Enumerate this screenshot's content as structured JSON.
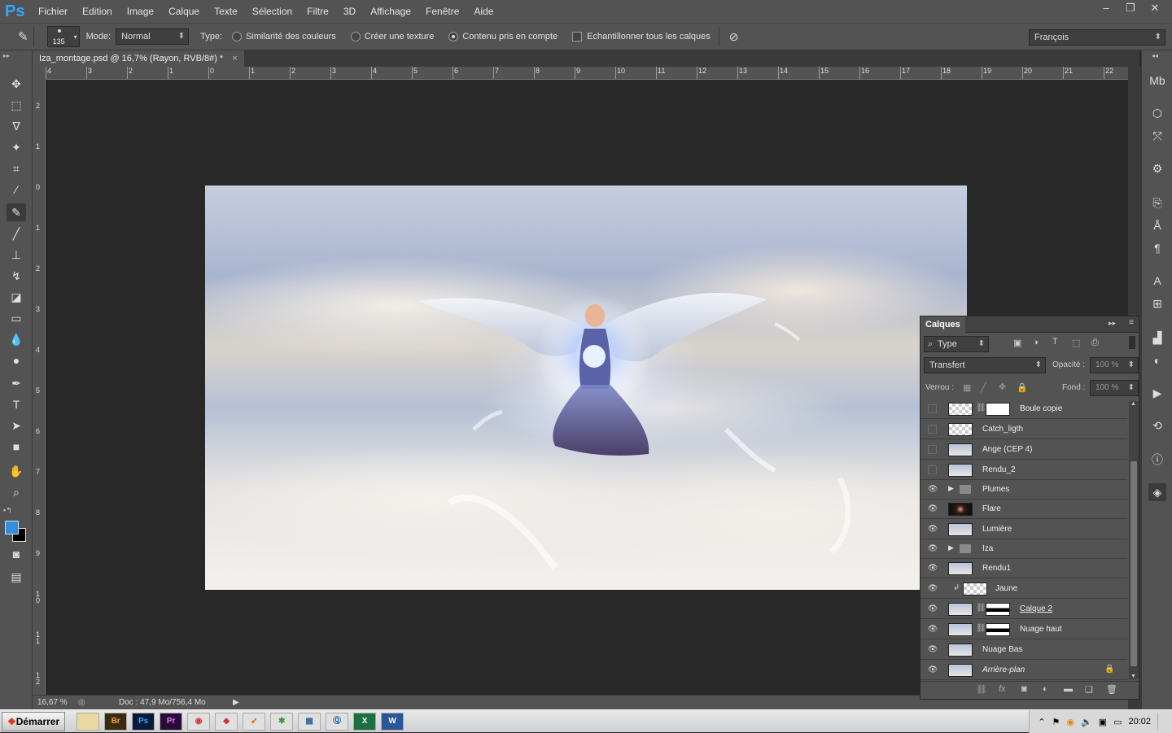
{
  "app": {
    "logo": "Ps"
  },
  "menu": [
    "Fichier",
    "Edition",
    "Image",
    "Calque",
    "Texte",
    "Sélection",
    "Filtre",
    "3D",
    "Affichage",
    "Fenêtre",
    "Aide"
  ],
  "window_controls": {
    "minimize": "–",
    "restore": "❐",
    "close": "✕"
  },
  "options": {
    "brush_size": "135",
    "mode_label": "Mode:",
    "mode_value": "Normal",
    "type_label": "Type:",
    "radio1": "Similarité des couleurs",
    "radio2": "Créer une texture",
    "radio3": "Contenu pris en compte",
    "checkbox": "Echantillonner tous les calques",
    "language": "François"
  },
  "document": {
    "tab_title": "Iza_montage.psd @ 16,7% (Rayon, RVB/8#) *",
    "close": "×"
  },
  "rulers": {
    "h": [
      "4",
      "3",
      "2",
      "1",
      "0",
      "1",
      "2",
      "3",
      "4",
      "5",
      "6",
      "7",
      "8",
      "9",
      "10",
      "11",
      "12",
      "13",
      "14",
      "15",
      "16",
      "17",
      "18",
      "19",
      "20",
      "21",
      "22"
    ],
    "v": [
      "2",
      "1",
      "0",
      "1",
      "2",
      "3",
      "4",
      "5",
      "6",
      "7",
      "8",
      "9",
      "1 0",
      "1 1",
      "1 2"
    ]
  },
  "status": {
    "zoom": "16,67 %",
    "doc": "Doc : 47,9 Mo/756,4 Mo"
  },
  "layers_panel": {
    "title": "Calques",
    "filter": "Type",
    "blend": "Transfert",
    "opacity_label": "Opacité :",
    "opacity": "100 %",
    "lock_label": "Verrou :",
    "fill_label": "Fond :",
    "fill": "100 %",
    "layers": [
      {
        "name": "Boule copie",
        "visible": false,
        "thumb": "checker",
        "mask": "white"
      },
      {
        "name": "Catch_ligth",
        "visible": false,
        "thumb": "checker"
      },
      {
        "name": "Ange (CEP 4)",
        "visible": false,
        "thumb": "sky"
      },
      {
        "name": "Rendu_2",
        "visible": false,
        "thumb": "sky"
      },
      {
        "name": "Plumes",
        "visible": true,
        "folder": true
      },
      {
        "name": "Flare",
        "visible": true,
        "thumb": "dark"
      },
      {
        "name": "Lumière",
        "visible": true,
        "thumb": "sky"
      },
      {
        "name": "Iza",
        "visible": true,
        "folder": true
      },
      {
        "name": "Rendu1",
        "visible": true,
        "thumb": "sky"
      },
      {
        "name": "Jaune",
        "visible": true,
        "thumb": "checker",
        "clipped": true
      },
      {
        "name": "Calque 2",
        "visible": true,
        "thumb": "sky",
        "mask": "mask"
      },
      {
        "name": "Nuage haut",
        "visible": true,
        "thumb": "sky",
        "mask": "mask"
      },
      {
        "name": "Nuage Bas",
        "visible": true,
        "thumb": "sky"
      },
      {
        "name": "Arrière-plan",
        "visible": true,
        "thumb": "sky",
        "locked": true
      }
    ]
  },
  "taskbar": {
    "start": "Démarrer",
    "apps": [
      "",
      "Br",
      "Ps",
      "Pr",
      "",
      "",
      "",
      "",
      "",
      "",
      "X",
      "W"
    ],
    "clock": "20:02"
  }
}
